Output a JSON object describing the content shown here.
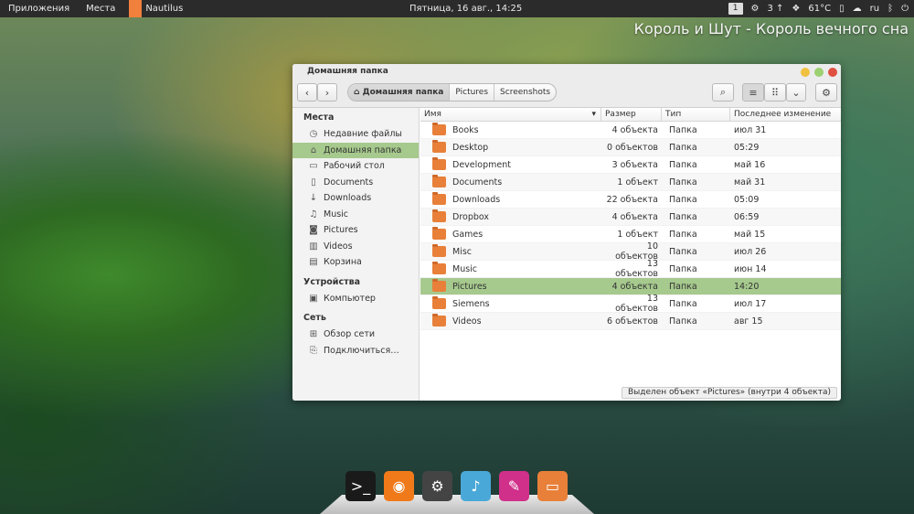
{
  "topbar": {
    "applications": "Приложения",
    "places": "Места",
    "app_name": "Nautilus",
    "clock": "Пятница, 16 авг., 14:25",
    "workspace": "1",
    "updates": "3 ↑",
    "temperature": "61°C",
    "language": "ru"
  },
  "now_playing": "Король и Шут - Король вечного сна",
  "window": {
    "title": "Домашняя папка",
    "breadcrumbs": [
      "Домашняя папка",
      "Pictures",
      "Screenshots"
    ]
  },
  "sidebar": {
    "places_header": "Места",
    "places": [
      {
        "label": "Недавние файлы",
        "icon": "clock-icon"
      },
      {
        "label": "Домашняя папка",
        "icon": "home-icon"
      },
      {
        "label": "Рабочий стол",
        "icon": "desktop-icon"
      },
      {
        "label": "Documents",
        "icon": "document-icon"
      },
      {
        "label": "Downloads",
        "icon": "download-icon"
      },
      {
        "label": "Music",
        "icon": "music-icon"
      },
      {
        "label": "Pictures",
        "icon": "camera-icon"
      },
      {
        "label": "Videos",
        "icon": "film-icon"
      },
      {
        "label": "Корзина",
        "icon": "trash-icon"
      }
    ],
    "devices_header": "Устройства",
    "devices": [
      {
        "label": "Компьютер",
        "icon": "computer-icon"
      }
    ],
    "network_header": "Сеть",
    "network": [
      {
        "label": "Обзор сети",
        "icon": "network-icon"
      },
      {
        "label": "Подключиться…",
        "icon": "connect-icon"
      }
    ]
  },
  "columns": {
    "name": "Имя",
    "size": "Размер",
    "type": "Тип",
    "modified": "Последнее изменение"
  },
  "files": [
    {
      "name": "Books",
      "size": "4 объекта",
      "type": "Папка",
      "modified": "июл 31"
    },
    {
      "name": "Desktop",
      "size": "0 объектов",
      "type": "Папка",
      "modified": "05:29"
    },
    {
      "name": "Development",
      "size": "3 объекта",
      "type": "Папка",
      "modified": "май 16"
    },
    {
      "name": "Documents",
      "size": "1 объект",
      "type": "Папка",
      "modified": "май 31"
    },
    {
      "name": "Downloads",
      "size": "22 объекта",
      "type": "Папка",
      "modified": "05:09"
    },
    {
      "name": "Dropbox",
      "size": "4 объекта",
      "type": "Папка",
      "modified": "06:59"
    },
    {
      "name": "Games",
      "size": "1 объект",
      "type": "Папка",
      "modified": "май 15"
    },
    {
      "name": "Misc",
      "size": "10 объектов",
      "type": "Папка",
      "modified": "июл 26"
    },
    {
      "name": "Music",
      "size": "13 объектов",
      "type": "Папка",
      "modified": "июн 14"
    },
    {
      "name": "Pictures",
      "size": "4 объекта",
      "type": "Папка",
      "modified": "14:20"
    },
    {
      "name": "Siemens",
      "size": "13 объектов",
      "type": "Папка",
      "modified": "июл 17"
    },
    {
      "name": "Videos",
      "size": "6 объектов",
      "type": "Папка",
      "modified": "авг 15"
    }
  ],
  "selected_file": "Pictures",
  "status": "Выделен объект «Pictures» (внутри 4 объекта)",
  "dock": [
    {
      "name": "terminal",
      "color": "#1a1a1a",
      "glyph": ">_"
    },
    {
      "name": "firefox",
      "color": "#f07a1a",
      "glyph": "◉"
    },
    {
      "name": "steam",
      "color": "#444444",
      "glyph": "⚙"
    },
    {
      "name": "music-player",
      "color": "#4aa8d8",
      "glyph": "♪"
    },
    {
      "name": "gimp",
      "color": "#d0308a",
      "glyph": "✎"
    },
    {
      "name": "files",
      "color": "#e8803a",
      "glyph": "▭"
    }
  ]
}
